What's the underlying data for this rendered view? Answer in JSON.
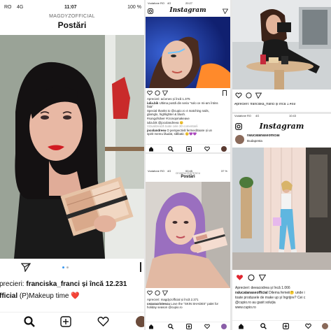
{
  "left": {
    "status": {
      "carrier": "RO",
      "net": "4G",
      "time": "11:07",
      "battery": "100 %"
    },
    "username": "MAGDYZOFFICIAL",
    "title": "Postări",
    "likes_prefix": "precieri:",
    "likes_user": "franciska_franci",
    "likes_suffix": "și încă 12.231",
    "caption_user": "fficial",
    "caption_text": "(P)Makeup time",
    "heart_emoji": "❤️"
  },
  "post_a": {
    "status": {
      "carrier": "Vodafone RO",
      "net": "4G",
      "time": "20:27",
      "battery": ""
    },
    "logo": "Instagram",
    "likes": "Aprecieri: ad.enes și încă 1.375",
    "caption_user": "iulia.bik",
    "caption_lines": [
      "Ultima postă din seria \"solo ce mi-am întins",
      "fata\"",
      "Special thanks to @cupio.ro 4 matching nails,",
      "glamglo, highlighter & blush.",
      "#songofsilver #cronopmakeave"
    ],
    "reply": "iulia.bik @jocolandreea 😊",
    "view_comments": "Vizualizează toate cele 30 comentarii",
    "comment_user": "jocolandreea",
    "comment_lines": [
      "O perspectivă fermecătoare și un",
      "spirit mereu lăudat, sălbatic 😊💜💜"
    ]
  },
  "post_b": {
    "status": {
      "carrier": "Vodafone RO",
      "net": "4G",
      "time": "00:45",
      "battery": "37 %"
    },
    "username": "CEZARACRISTESCU",
    "title": "Postări",
    "likes": "Aprecieri: magdyzofficial și încă 2.371",
    "caption_user": "cezaracristescu",
    "caption_lines": [
      "Love the \"SKIN SHADES\" palet for",
      "holiday season @cupio.ro"
    ]
  },
  "post_c": {
    "likes": "Aprecieri: franciska_franci și încă 1.469"
  },
  "post_d": {
    "status": {
      "carrier": "Vodafone RO",
      "net": "4G",
      "time": "10:43",
      "battery": ""
    },
    "logo": "Instagram",
    "username": "ralucatanaseofficial",
    "location": "Budapesta",
    "likes": "Aprecieri: deeacodrea și încă 1.066",
    "caption_user": "ralucatanaseofficial",
    "caption_lines": [
      "Dilema femeii🤔 unde i",
      "toate produsele de make up și îngrijire? Cei c",
      "@cupio.ro au gasit soluția",
      "www.cupio.ro"
    ]
  },
  "icons": [
    "heart-icon",
    "comment-icon",
    "send-icon",
    "bookmark-icon",
    "home-icon",
    "search-icon",
    "add-icon",
    "camera-icon"
  ]
}
